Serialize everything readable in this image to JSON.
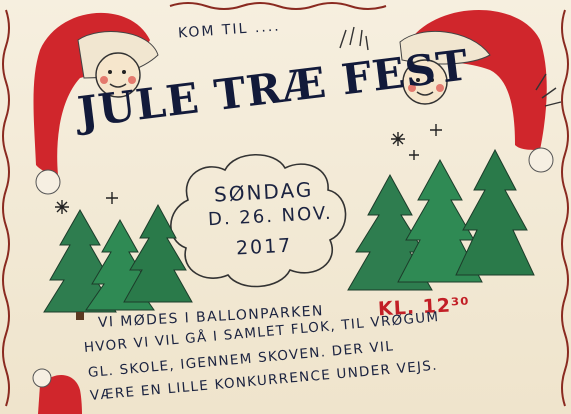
{
  "poster": {
    "intro": "KOM TIL ....",
    "title": "JULE TRÆ FEST",
    "day": "SØNDAG",
    "date": "D. 26. NOV.",
    "year": "2017",
    "line1": "VI MØDES I BALLONPARKEN",
    "time": "KL. 12³⁰",
    "line2": "HVOR VI VIL GÅ I SAMLET FLOK, TIL VRØGUM",
    "line3": "GL. SKOLE, IGENNEM SKOVEN. DER VIL",
    "line4": "VÆRE EN LILLE KONKURRENCE UNDER VEJS."
  },
  "colors": {
    "paper": "#f3ead6",
    "ink": "#1b2340",
    "hat_red": "#d0262c",
    "tree_green": "#2e7d4f",
    "border_red": "#b3262a"
  },
  "icons": [
    "santa-hat-left-icon",
    "santa-hat-right-icon",
    "santa-hat-bottom-icon",
    "christmas-tree-icon",
    "star-sparkle-icon",
    "cloud-frame-icon",
    "wavy-border-icon"
  ]
}
